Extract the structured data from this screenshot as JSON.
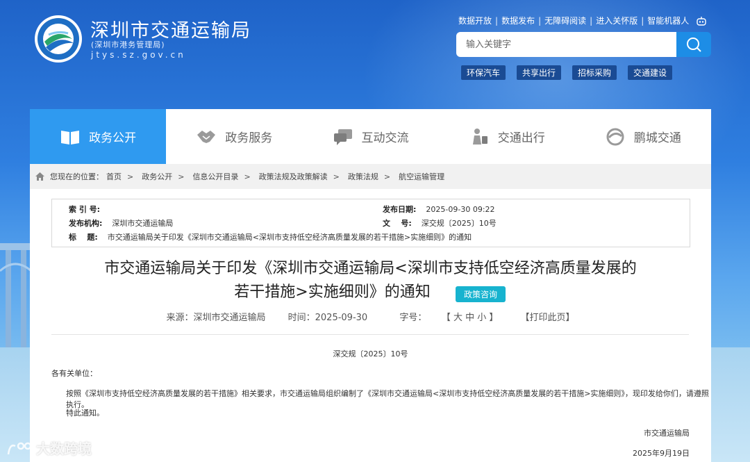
{
  "header": {
    "title": "深圳市交通运输局",
    "subtitle": "(深圳市港务管理局)",
    "domain": "jtys.sz.gov.cn"
  },
  "toplinks": [
    "数据开放",
    "数据发布",
    "无障碍阅读",
    "进入关怀版",
    "智能机器人"
  ],
  "search": {
    "placeholder": "输入关键字"
  },
  "hotlinks": [
    "环保汽车",
    "共享出行",
    "招标采购",
    "交通建设"
  ],
  "nav": [
    {
      "label": "政务公开",
      "icon": "book-icon",
      "active": true
    },
    {
      "label": "政务服务",
      "icon": "handshake-icon",
      "active": false
    },
    {
      "label": "互动交流",
      "icon": "chat-icon",
      "active": false
    },
    {
      "label": "交通出行",
      "icon": "traveler-icon",
      "active": false
    },
    {
      "label": "鹏城交通",
      "icon": "swirl-icon",
      "active": false
    }
  ],
  "breadcrumb": {
    "label": "您现在的位置：",
    "items": [
      "首页",
      "政务公开",
      "信息公开目录",
      "政策法规及政策解读",
      "政策法规",
      "航空运输管理"
    ]
  },
  "meta": {
    "index_label": "索 引 号:",
    "index_value": "",
    "date_label": "发布日期:",
    "date_value": "2025-09-30 09:22",
    "org_label": "发布机构:",
    "org_value": "深圳市交通运输局",
    "docno_label": "文    号:",
    "docno_value": "深交规〔2025〕10号",
    "title_label": "标    题:",
    "title_value": "市交通运输局关于印发《深圳市交通运输局<深圳市支持低空经济高质量发展的若干措施>实施细则》的通知"
  },
  "article": {
    "title_line1": "市交通运输局关于印发《深圳市交通运输局<深圳市支持低空经济高质量发展的",
    "title_line2": "若干措施>实施细则》的通知",
    "consult_button": "政策咨询",
    "source": "来源：深圳市交通运输局",
    "time": "时间：2025-09-30",
    "font_size_label": "字号：",
    "font_sizes": "【 大 中 小 】",
    "print": "【打印此页】",
    "doc_number": "深交规〔2025〕10号",
    "addressee": "各有关单位：",
    "body": "按照《深圳市支持低空经济高质量发展的若干措施》相关要求，市交通运输局组织编制了《深圳市交通运输局<深圳市支持低空经济高质量发展的若干措施>实施细则》，现印发给你们，请遵照执行。",
    "closing": "特此通知。",
    "signature": "市交通运输局",
    "sign_date": "2025年9月19日"
  },
  "watermark": "大数跨境",
  "colors": {
    "nav_active": "#2f9af0",
    "search_button": "#1d8de6",
    "consult": "#17b3cf",
    "hot_tag": "#1a4b94"
  }
}
